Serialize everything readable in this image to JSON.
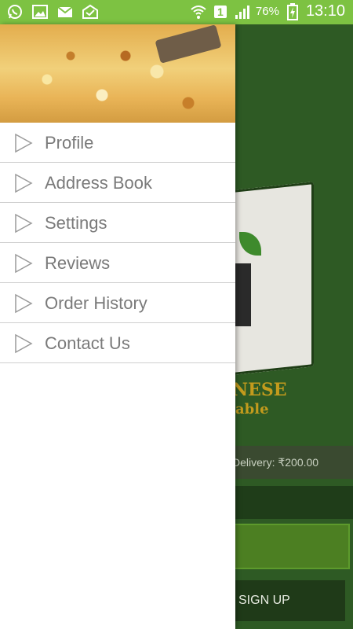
{
  "status_bar": {
    "battery_percent": "76%",
    "time": "13:10",
    "sim_badge": "1",
    "background_color": "#7dc242"
  },
  "background_app": {
    "brand_partial": "NESE",
    "brand_sub_partial": "able",
    "delivery_text": "Delivery: ₹200.00",
    "signup_label": "SIGN UP"
  },
  "drawer": {
    "menu": [
      {
        "label": "Profile",
        "icon": "play-triangle-icon"
      },
      {
        "label": "Address Book",
        "icon": "play-triangle-icon"
      },
      {
        "label": "Settings",
        "icon": "play-triangle-icon"
      },
      {
        "label": "Reviews",
        "icon": "play-triangle-icon"
      },
      {
        "label": "Order History",
        "icon": "play-triangle-icon"
      },
      {
        "label": "Contact Us",
        "icon": "play-triangle-icon"
      }
    ]
  }
}
